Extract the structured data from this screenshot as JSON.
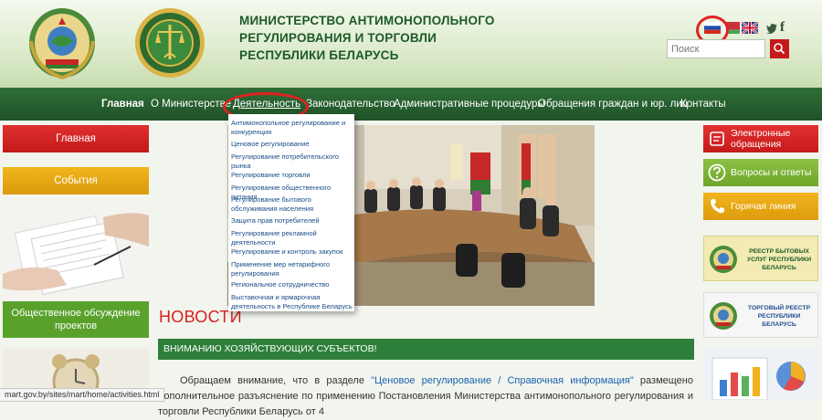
{
  "header": {
    "title_lines": [
      "МИНИСТЕРСТВО АНТИМОНОПОЛЬНОГО",
      "РЕГУЛИРОВАНИЯ И ТОРГОВЛИ",
      "РЕСПУБЛИКИ БЕЛАРУСЬ"
    ],
    "search_placeholder": "Поиск",
    "social_facebook": "f"
  },
  "nav": {
    "items": [
      "Главная",
      "О Министерстве",
      "Деятельность",
      "Законодательство",
      "Административные процедуры",
      "Обращения граждан и юр. лиц",
      "Контакты"
    ]
  },
  "dropdown": {
    "items": [
      "Антимонопольное регулирование и конкуренция",
      "Ценовое регулирование",
      "Регулирование потребительского рынка",
      "Регулирование торговли",
      "Регулирование общественного питания",
      "Регулирование бытового обслуживания населения",
      "Защита прав потребителей",
      "Регулирование рекламной деятельности",
      "Регулирование и контроль закупок",
      "Применение мер нетарифного регулирования",
      "Региональное сотрудничество",
      "Выставочная и ярмарочная деятельность в Республике Беларусь"
    ]
  },
  "left_sidebar": {
    "main_label": "Главная",
    "events_label": "События",
    "discussion_label": "Общественное обсуждение проектов"
  },
  "right_sidebar": {
    "electronic_label": "Электронные обращения",
    "qa_label": "Вопросы и ответы",
    "hotline_label": "Горячая линия",
    "registry_services": "РЕЕСТР БЫТОВЫХ УСЛУГ РЕСПУБЛИКИ БЕЛАРУСЬ",
    "registry_trade": "ТОРГОВЫЙ РЕЕСТР РЕСПУБЛИКИ БЕЛАРУСЬ"
  },
  "news": {
    "heading": "НОВОСТИ",
    "banner": "ВНИМАНИЮ ХОЗЯЙСТВУЮЩИХ СУБЪЕКТОВ!",
    "text_before": "Обращаем внимание, что в разделе ",
    "text_link": "\"Ценовое регулирование / Справочная информация\"",
    "text_after": " размещено дополнительное разъяснение по применению Постановления Министерства антимонопольного регулирования и торговли Республики Беларусь от 4"
  },
  "status_url": "mart.gov.by/sites/mart/home/activities.html",
  "colors": {
    "nav_bg": "#2f6e37",
    "accent_red": "#c61a1a",
    "accent_yellow": "#f1b51d",
    "accent_green": "#5aa12c",
    "link_blue": "#1a4d8a"
  }
}
